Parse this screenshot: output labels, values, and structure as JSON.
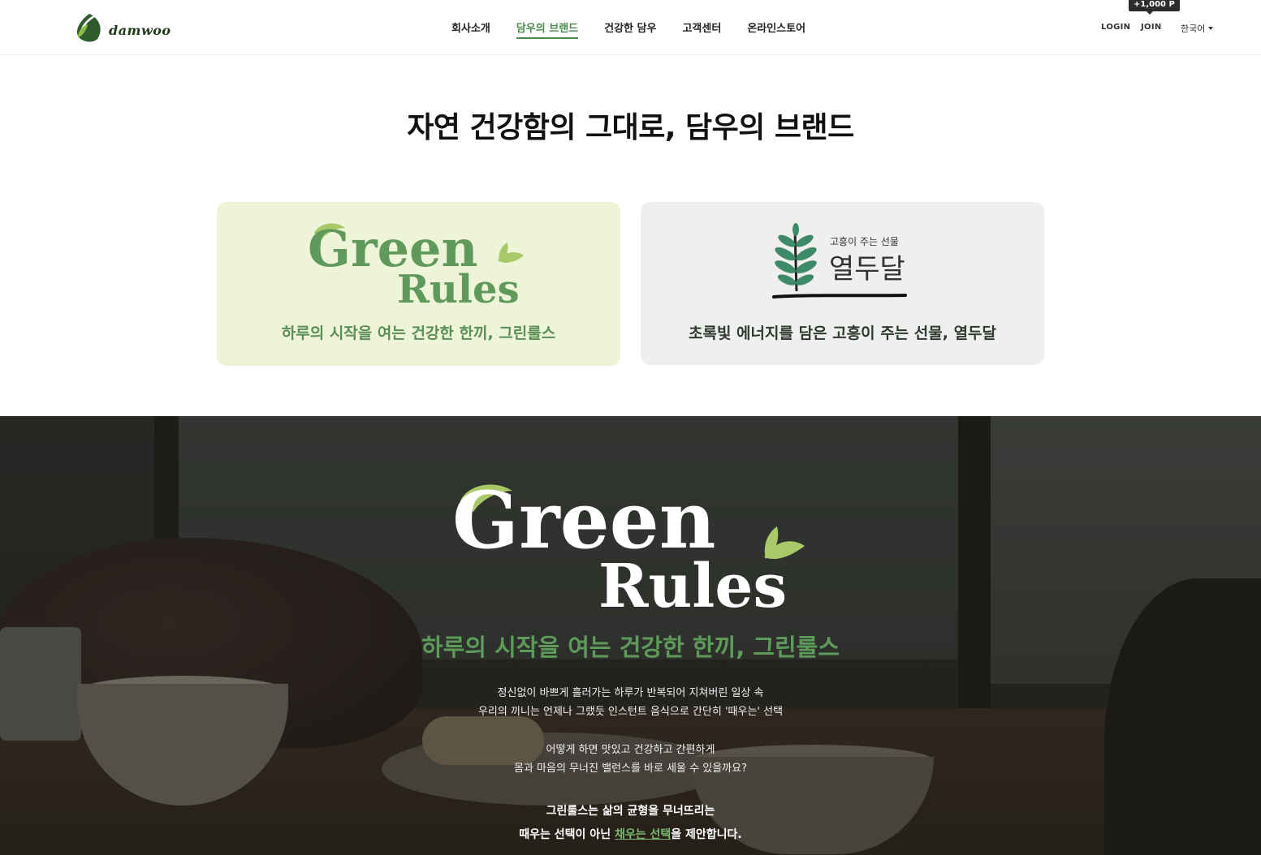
{
  "header": {
    "logo_text": "damwoo",
    "nav": [
      "회사소개",
      "담우의 브랜드",
      "건강한 담우",
      "고객센터",
      "온라인스토어"
    ],
    "active_nav": "담우의 브랜드",
    "login": "LOGIN",
    "join": "JOIN",
    "join_points": "+1,000 P",
    "language": "한국어"
  },
  "hero": {
    "title": "자연 건강함의 그대로, 담우의 브랜드"
  },
  "brands": [
    {
      "logo_word1": "Green",
      "logo_word2": "Rules",
      "tagline": "하루의 시작을 여는 건강한 한끼, 그린룰스"
    },
    {
      "logo_small": "고흥이 주는 선물",
      "logo_main": "열두달",
      "tagline": "초록빛 에너지를 담은 고흥이 주는 선물, 열두달"
    }
  ],
  "feature": {
    "logo_word1": "Green",
    "logo_word2": "Rules",
    "tagline": "하루의 시작을 여는 건강한 한끼, 그린룰스",
    "paragraph1": [
      "정신없이 바쁘게 흘러가는 하루가 반복되어 지쳐버린 일상 속",
      "우리의 끼니는 언제나 그랬듯 인스턴트 음식으로 간단히 '때우는' 선택"
    ],
    "paragraph2": [
      "어떻게 하면 맛있고 건강하고 간편하게",
      "몸과 마음의 무너진 밸런스를 바로 세울 수 있을까요?"
    ],
    "paragraph3_line1": "그린룰스는 삶의 균형을 무너뜨리는",
    "paragraph3_line2_pre": "때우는 선택이 아닌 ",
    "paragraph3_highlight": "채우는 선택",
    "paragraph3_line2_post": "을 제안합니다."
  },
  "colors": {
    "brand_green": "#4a8b4c",
    "leaf_light": "#a9c867",
    "card_green_bg": "#eef4d7",
    "card_gray_bg": "#efefef"
  }
}
